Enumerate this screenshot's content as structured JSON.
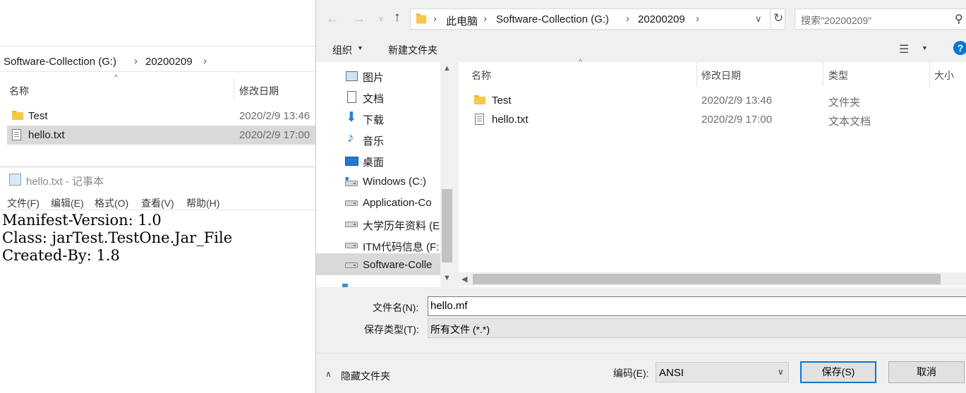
{
  "left_explorer": {
    "breadcrumb": [
      "Software-Collection (G:)",
      "20200209"
    ],
    "columns": {
      "name": "名称",
      "modified": "修改日期"
    },
    "files": [
      {
        "name": "Test",
        "modified": "2020/2/9 13:46",
        "type": "folder"
      },
      {
        "name": "hello.txt",
        "modified": "2020/2/9 17:00",
        "type": "text"
      }
    ]
  },
  "notepad": {
    "title": "hello.txt - 记事本",
    "menu": [
      "文件(F)",
      "编辑(E)",
      "格式(O)",
      "查看(V)",
      "帮助(H)"
    ],
    "lines": [
      "Manifest-Version: 1.0",
      "Class: jarTest.TestOne.Jar_File",
      "Created-By: 1.8"
    ]
  },
  "dialog": {
    "address": [
      "此电脑",
      "Software-Collection (G:)",
      "20200209"
    ],
    "search_placeholder": "搜索\"20200209\"",
    "toolbar": {
      "organize": "组织",
      "new_folder": "新建文件夹"
    },
    "nav_items": [
      {
        "label": "图片",
        "icon": "pictures-icon"
      },
      {
        "label": "文档",
        "icon": "documents-icon"
      },
      {
        "label": "下载",
        "icon": "download-icon"
      },
      {
        "label": "音乐",
        "icon": "music-icon"
      },
      {
        "label": "桌面",
        "icon": "desktop-icon"
      },
      {
        "label": "Windows (C:)",
        "icon": "windows-drive-icon"
      },
      {
        "label": "Application-Co",
        "icon": "drive-icon"
      },
      {
        "label": "大学历年资料 (E:",
        "icon": "drive-icon"
      },
      {
        "label": "ITM代码信息 (F:",
        "icon": "drive-icon"
      },
      {
        "label": "Software-Colle",
        "icon": "drive-icon",
        "selected": true
      }
    ],
    "columns": {
      "name": "名称",
      "modified": "修改日期",
      "type": "类型",
      "size": "大小"
    },
    "files": [
      {
        "name": "Test",
        "modified": "2020/2/9 13:46",
        "type": "文件夹"
      },
      {
        "name": "hello.txt",
        "modified": "2020/2/9 17:00",
        "type": "文本文档"
      }
    ],
    "filename_label": "文件名(N):",
    "filename_value": "hello.mf",
    "savetype_label": "保存类型(T):",
    "savetype_value": "所有文件  (*.*)",
    "hide_folders": "隐藏文件夹",
    "encoding_label": "编码(E):",
    "encoding_value": "ANSI",
    "save_button": "保存(S)",
    "cancel_button": "取消"
  },
  "colors": {
    "accent": "#0078d7",
    "selected": "#cce8ff",
    "folder": "#f7c948"
  }
}
